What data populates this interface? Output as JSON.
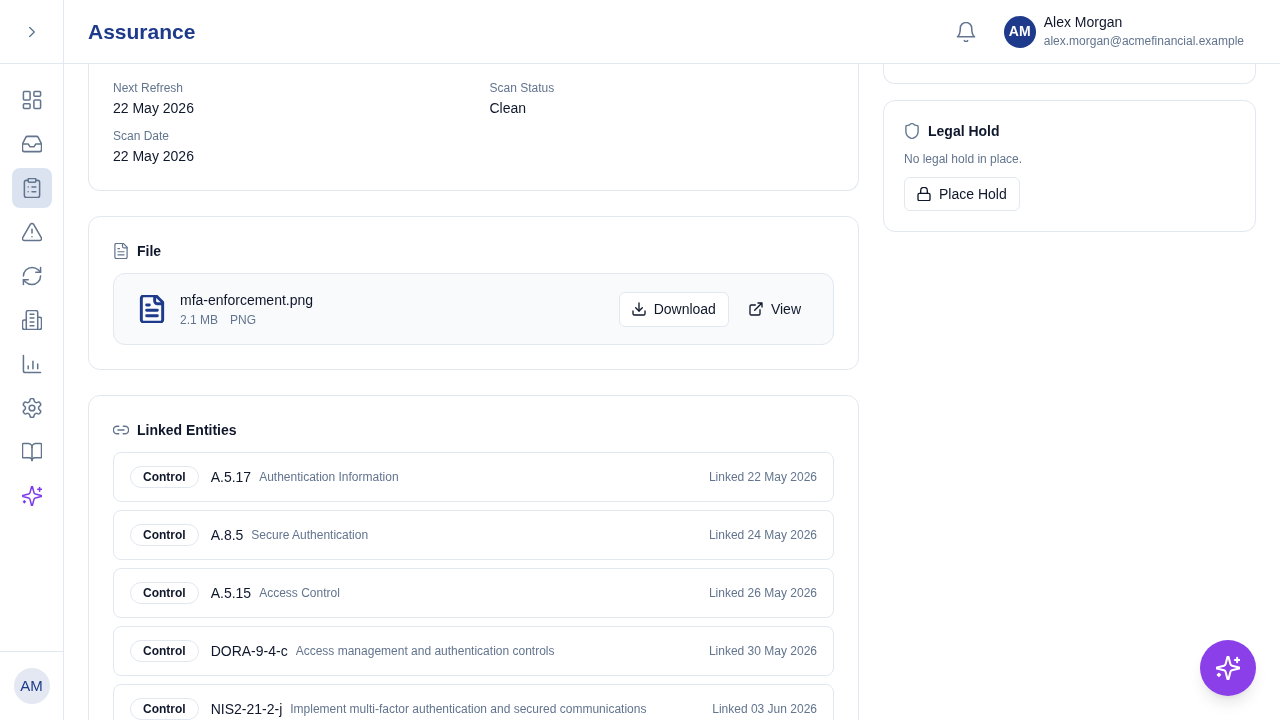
{
  "sidebar": {
    "items": [
      {
        "kind": "link",
        "selected": false
      },
      {
        "kind": "link",
        "selected": false
      },
      {
        "kind": "link",
        "selected": true
      },
      {
        "kind": "link",
        "selected": false
      },
      {
        "kind": "link",
        "selected": false
      },
      {
        "kind": "link",
        "selected": false
      },
      {
        "kind": "link",
        "selected": false
      },
      {
        "kind": "link",
        "selected": false
      },
      {
        "kind": "link",
        "selected": false
      },
      {
        "kind": "assistant",
        "selected": false
      }
    ],
    "user": {
      "initials": "AM"
    }
  },
  "header": {
    "title": "Assurance",
    "user": {
      "initials": "AM",
      "name": "Alex Morgan",
      "email": "alex.morgan@acmefinancial.example"
    }
  },
  "details": {
    "fields": [
      {
        "label": "Next Refresh",
        "value": "22 May 2026"
      },
      {
        "label": "Scan Status",
        "value": "Clean"
      },
      {
        "label": "Scan Date",
        "value": "22 May 2026"
      }
    ]
  },
  "file": {
    "title": "File",
    "name": "mfa-enforcement.png",
    "size": "2.1 MB",
    "format": "PNG",
    "actions": [
      {
        "label": "Download",
        "kind": "download"
      },
      {
        "label": "View",
        "kind": "external"
      }
    ]
  },
  "linked_entities": {
    "title": "Linked Entities",
    "rows": [
      {
        "type": "Control",
        "code": "A.5.17",
        "description": "Authentication Information",
        "linked": "Linked 22 May 2026"
      },
      {
        "type": "Control",
        "code": "A.8.5",
        "description": "Secure Authentication",
        "linked": "Linked 24 May 2026"
      },
      {
        "type": "Control",
        "code": "A.5.15",
        "description": "Access Control",
        "linked": "Linked 26 May 2026"
      },
      {
        "type": "Control",
        "code": "DORA-9-4-c",
        "description": "Access management and authentication controls",
        "linked": "Linked 30 May 2026"
      },
      {
        "type": "Control",
        "code": "NIS2-21-2-j",
        "description": "Implement multi-factor authentication and secured communications",
        "linked": "Linked 03 Jun 2026"
      }
    ]
  },
  "legal_hold": {
    "title": "Legal Hold",
    "message": "No legal hold in place.",
    "button": "Place Hold"
  }
}
